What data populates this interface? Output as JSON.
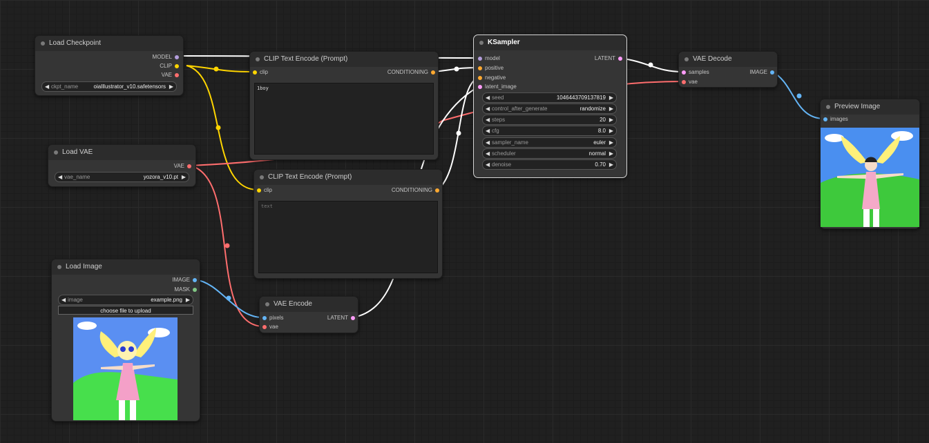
{
  "colors": {
    "model": "#b39ddb",
    "clip": "#ffd500",
    "vae": "#ff6e6e",
    "conditioning": "#ffa931",
    "latent": "#ff9cf9",
    "image": "#64b5f6",
    "mask": "#81c784",
    "wire_model": "#ffffff"
  },
  "nodes": {
    "load_checkpoint": {
      "title": "Load Checkpoint",
      "outputs": [
        "MODEL",
        "CLIP",
        "VAE"
      ],
      "ckpt_label": "ckpt_name",
      "ckpt_value": "oiaIllustrator_v10.safetensors"
    },
    "load_vae": {
      "title": "Load VAE",
      "output": "VAE",
      "vae_label": "vae_name",
      "vae_value": "yozora_v10.pt"
    },
    "clip_pos": {
      "title": "CLIP Text Encode (Prompt)",
      "input": "clip",
      "output": "CONDITIONING",
      "text": "1boy"
    },
    "clip_neg": {
      "title": "CLIP Text Encode (Prompt)",
      "input": "clip",
      "output": "CONDITIONING",
      "text": "text"
    },
    "ksampler": {
      "title": "KSampler",
      "inputs": [
        "model",
        "positive",
        "negative",
        "latent_image"
      ],
      "output": "LATENT",
      "widgets": [
        {
          "label": "seed",
          "value": "1046443709137819"
        },
        {
          "label": "control_after_generate",
          "value": "randomize"
        },
        {
          "label": "steps",
          "value": "20"
        },
        {
          "label": "cfg",
          "value": "8.0"
        },
        {
          "label": "sampler_name",
          "value": "euler"
        },
        {
          "label": "scheduler",
          "value": "normal"
        },
        {
          "label": "denoise",
          "value": "0.70"
        }
      ]
    },
    "vae_decode": {
      "title": "VAE Decode",
      "inputs": [
        "samples",
        "vae"
      ],
      "output": "IMAGE"
    },
    "preview_image": {
      "title": "Preview Image",
      "input": "images"
    },
    "load_image": {
      "title": "Load Image",
      "outputs": [
        "IMAGE",
        "MASK"
      ],
      "image_label": "image",
      "image_value": "example.png",
      "upload_label": "choose file to upload"
    },
    "vae_encode": {
      "title": "VAE Encode",
      "inputs": [
        "pixels",
        "vae"
      ],
      "output": "LATENT"
    }
  }
}
